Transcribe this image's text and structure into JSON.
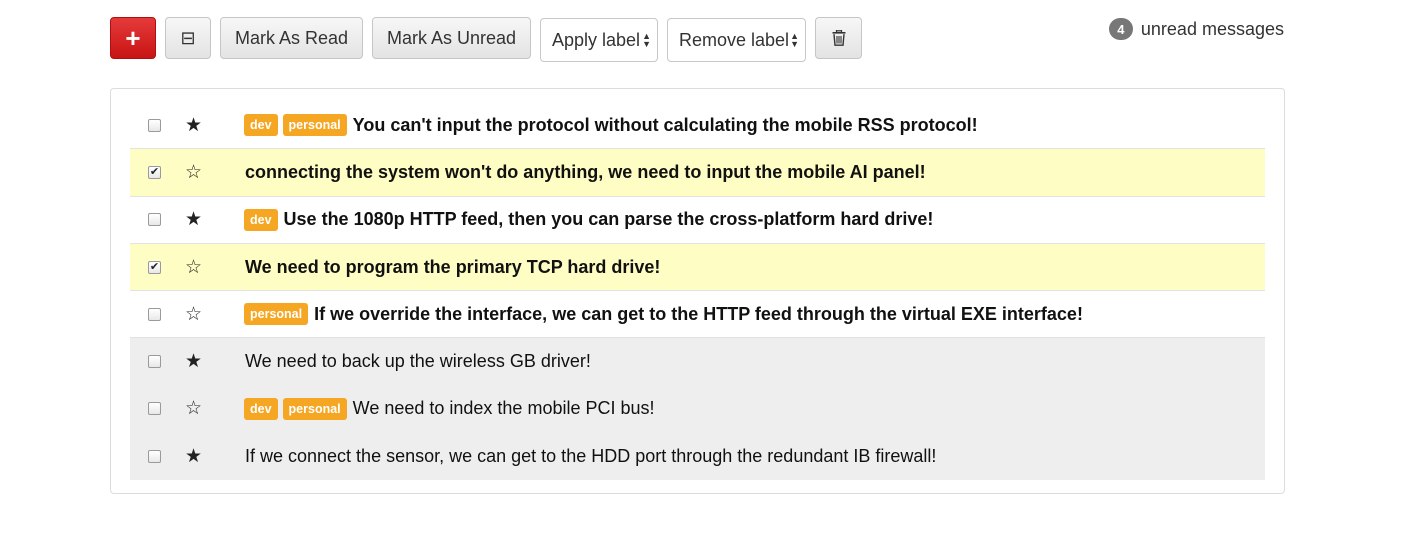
{
  "toolbar": {
    "add_glyph": "+",
    "collapse_glyph": "⊟",
    "mark_read": "Mark As Read",
    "mark_unread": "Mark As Unread",
    "apply_label": "Apply label",
    "remove_label": "Remove label",
    "delete_glyph": "🗑"
  },
  "unread": {
    "count": "4",
    "text": "unread messages"
  },
  "colors": {
    "accent_red": "#d9231f",
    "label_orange": "#f5a623",
    "selected_row": "#fefdc4",
    "read_row": "#eeeeee"
  },
  "messages": [
    {
      "subject": "You can't input the protocol without calculating the mobile RSS protocol!",
      "labels": [
        "dev",
        "personal"
      ],
      "starred": true,
      "checked": false,
      "read": false
    },
    {
      "subject": "connecting the system won't do anything, we need to input the mobile AI panel!",
      "labels": [],
      "starred": false,
      "checked": true,
      "read": false
    },
    {
      "subject": "Use the 1080p HTTP feed, then you can parse the cross-platform hard drive!",
      "labels": [
        "dev"
      ],
      "starred": true,
      "checked": false,
      "read": false
    },
    {
      "subject": "We need to program the primary TCP hard drive!",
      "labels": [],
      "starred": false,
      "checked": true,
      "read": false
    },
    {
      "subject": "If we override the interface, we can get to the HTTP feed through the virtual EXE interface!",
      "labels": [
        "personal"
      ],
      "starred": false,
      "checked": false,
      "read": false
    },
    {
      "subject": "We need to back up the wireless GB driver!",
      "labels": [],
      "starred": true,
      "checked": false,
      "read": true
    },
    {
      "subject": "We need to index the mobile PCI bus!",
      "labels": [
        "dev",
        "personal"
      ],
      "starred": false,
      "checked": false,
      "read": true
    },
    {
      "subject": "If we connect the sensor, we can get to the HDD port through the redundant IB firewall!",
      "labels": [],
      "starred": true,
      "checked": false,
      "read": true
    }
  ]
}
